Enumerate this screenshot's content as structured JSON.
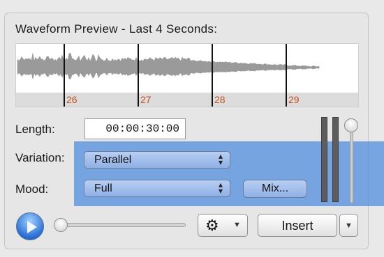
{
  "panel": {
    "title": "Waveform Preview - Last 4 Seconds:"
  },
  "waveform": {
    "markers": [
      "26",
      "27",
      "28",
      "29"
    ],
    "marker_color": "#c0521e"
  },
  "length": {
    "label": "Length:",
    "value": "00:00:30:00"
  },
  "variation": {
    "label": "Variation:",
    "selected": "Parallel"
  },
  "mood": {
    "label": "Mood:",
    "selected": "Full",
    "mix_label": "Mix..."
  },
  "controls": {
    "insert_label": "Insert",
    "gear_icon": "gear-icon",
    "play_icon": "play-icon"
  },
  "colors": {
    "selection_highlight": "#4a8ade",
    "popup_blue": "#a6c2ee"
  }
}
